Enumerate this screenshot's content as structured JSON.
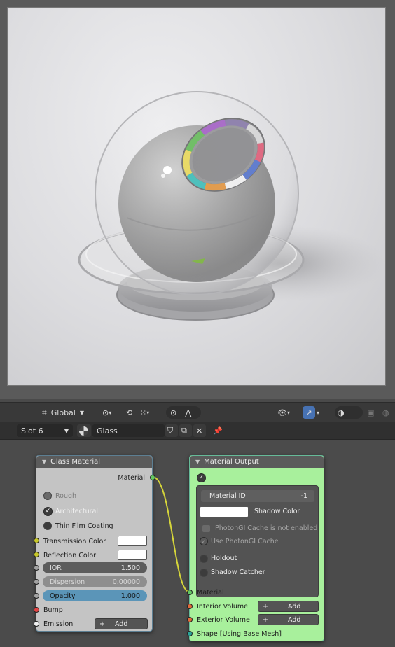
{
  "toolbar": {
    "orientation_label": "Global"
  },
  "material_bar": {
    "slot_label": "Slot 6",
    "material_name": "Glass"
  },
  "glass_node": {
    "title": "Glass Material",
    "output_material": "Material",
    "rough_label": "Rough",
    "architectural_label": "Architectural",
    "thin_film_label": "Thin Film Coating",
    "transmission_color_label": "Transmission Color",
    "reflection_color_label": "Reflection Color",
    "ior_label": "IOR",
    "ior_value": "1.500",
    "dispersion_label": "Dispersion",
    "dispersion_value": "0.00000",
    "opacity_label": "Opacity",
    "opacity_value": "1.000",
    "bump_label": "Bump",
    "emission_label": "Emission",
    "add_label": "Add"
  },
  "output_node": {
    "title": "Material Output",
    "material_id_label": "Material ID",
    "material_id_value": "-1",
    "shadow_color_label": "Shadow Color",
    "photongi_note": "PhotonGI Cache is not enabled",
    "use_photongi_label": "Use PhotonGI Cache",
    "holdout_label": "Holdout",
    "shadow_catcher_label": "Shadow Catcher",
    "material_input": "Material",
    "interior_volume_label": "Interior Volume",
    "exterior_volume_label": "Exterior Volume",
    "add_label": "Add",
    "shape_label": "Shape [Using Base Mesh]"
  },
  "colors": {
    "node_glass_body": "#c4c4c4",
    "node_output_body": "#a8f09c",
    "link_color": "#d6d63a",
    "accent_blue": "#4772b3"
  }
}
